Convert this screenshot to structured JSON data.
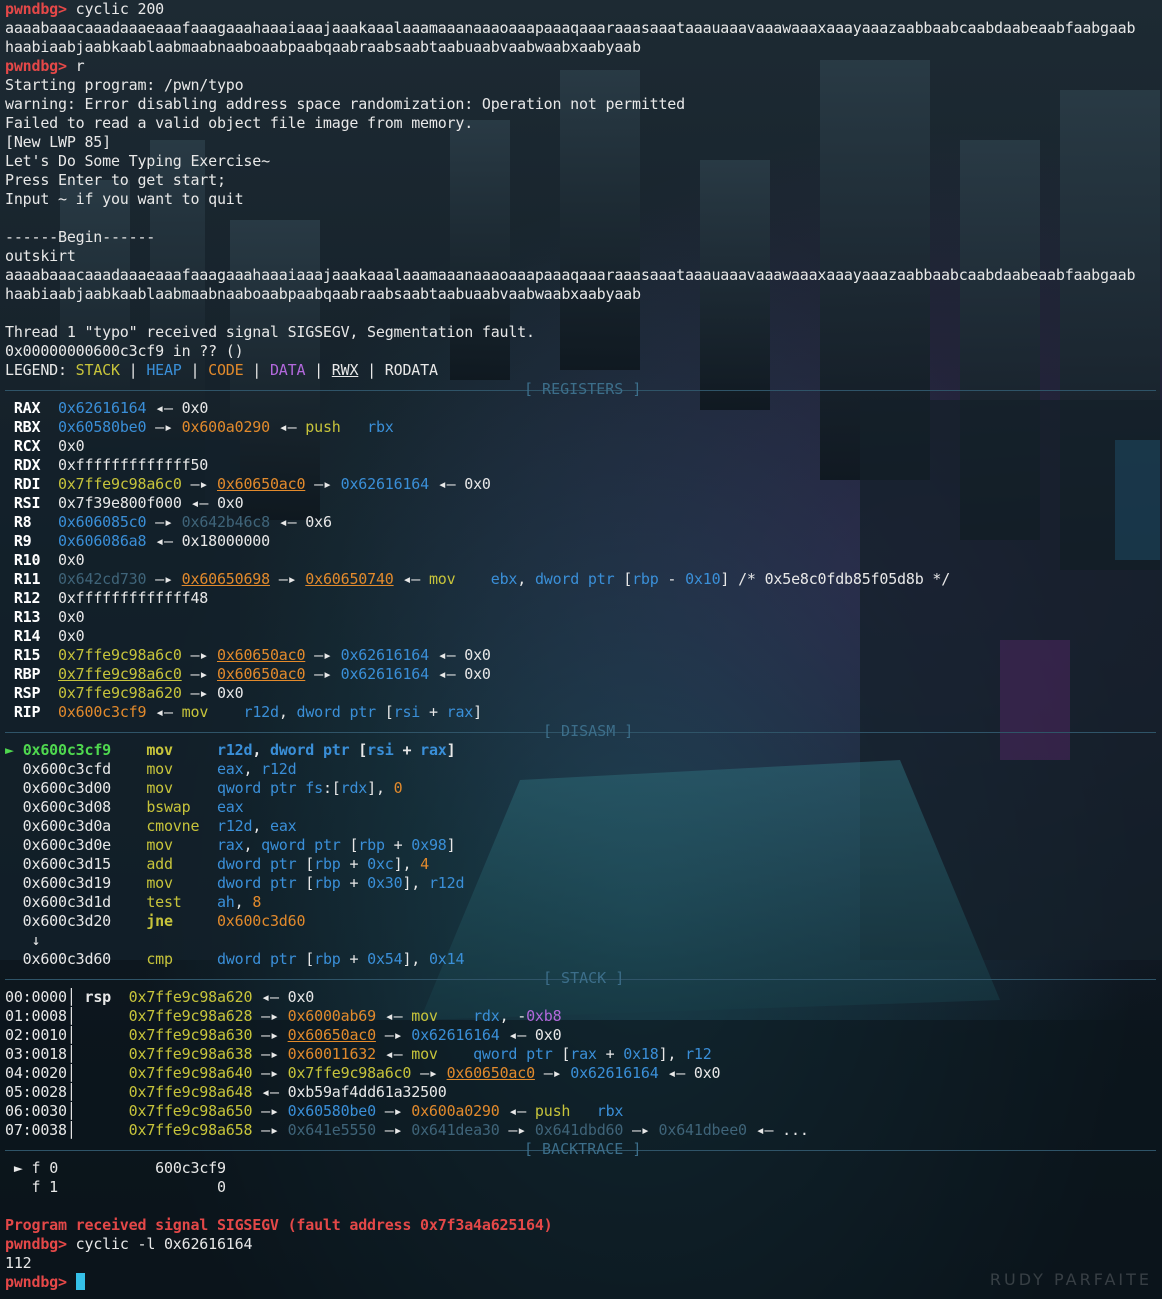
{
  "prompt": "pwndbg>",
  "commands": {
    "cyclic": "cyclic 200",
    "run": "r",
    "lookup": "cyclic -l 0x62616164"
  },
  "cyclic_output": [
    "aaaabaaacaaadaaaeaaafaaagaaahaaaiaaajaaakaaalaaamaaanaaaoaaapaaaqaaaraaasaaataaauaaavaaawaaaxaaayaaazaabbaabcaabdaabeaabfaabgaab",
    "haabiaabjaabkaablaabmaabnaaboaabpaabqaabraabsaabtaabuaabvaabwaabxaabyaab"
  ],
  "program_output": [
    "Starting program: /pwn/typo",
    "warning: Error disabling address space randomization: Operation not permitted",
    "Failed to read a valid object file image from memory.",
    "[New LWP 85]",
    "Let's Do Some Typing Exercise~",
    "Press Enter to get start;",
    "Input ~ if you want to quit",
    "",
    "------Begin------",
    "outskirt",
    "aaaabaaacaaadaaaeaaafaaagaaahaaaiaaajaaakaaalaaamaaanaaaoaaapaaaqaaaraaasaaataaauaaavaaawaaaxaaayaaazaabbaabcaabdaabeaabfaabgaab",
    "haabiaabjaabkaablaabmaabnaaboaabpaabqaabraabsaabtaabuaabvaabwaabxaabyaab",
    "",
    "Thread 1 \"typo\" received signal SIGSEGV, Segmentation fault.",
    "0x00000000600c3cf9 in ?? ()"
  ],
  "legend": {
    "label": "LEGEND: ",
    "stack": "STACK",
    "heap": "HEAP",
    "code": "CODE",
    "data": "DATA",
    "rwx": "RWX",
    "rodata": "RODATA",
    "sep": " | "
  },
  "section_titles": {
    "registers": "[ REGISTERS ]",
    "disasm": "[ DISASM ]",
    "stack": "[ STACK ]",
    "backtrace": "[ BACKTRACE ]"
  },
  "registers": [
    {
      "name": "RAX",
      "value": "0x62616164",
      "rest": " ◂— 0x0"
    },
    {
      "name": "RBX",
      "value": "0x60580be0",
      "rest": " —▸ 0x600a0290 ◂— push   rbx"
    },
    {
      "name": "RCX",
      "value": "0x0",
      "rest": ""
    },
    {
      "name": "RDX",
      "value": "0xfffffffffffff50",
      "rest": ""
    },
    {
      "name": "RDI",
      "value": "0x7ffe9c98a6c0",
      "rest": " —▸ 0x60650ac0 —▸ 0x62616164 ◂— 0x0"
    },
    {
      "name": "RSI",
      "value": "0x7f39e800f000",
      "rest": " ◂— 0x0"
    },
    {
      "name": "R8",
      "value": "0x606085c0",
      "rest": " —▸ 0x642b46c8 ◂— 0x6"
    },
    {
      "name": "R9",
      "value": "0x606086a8",
      "rest": " ◂— 0x18000000"
    },
    {
      "name": "R10",
      "value": "0x0",
      "rest": ""
    },
    {
      "name": "R11",
      "value": "0x642cd730",
      "rest": " —▸ 0x60650698 —▸ 0x60650740 ◂— mov    ebx, dword ptr [rbp - 0x10] /* 0x5e8c0fdb85f05d8b */"
    },
    {
      "name": "R12",
      "value": "0xfffffffffffff48",
      "rest": ""
    },
    {
      "name": "R13",
      "value": "0x0",
      "rest": ""
    },
    {
      "name": "R14",
      "value": "0x0",
      "rest": ""
    },
    {
      "name": "R15",
      "value": "0x7ffe9c98a6c0",
      "rest": " —▸ 0x60650ac0 —▸ 0x62616164 ◂— 0x0"
    },
    {
      "name": "RBP",
      "value": "0x7ffe9c98a6c0",
      "rest": " —▸ 0x60650ac0 —▸ 0x62616164 ◂— 0x0"
    },
    {
      "name": "RSP",
      "value": "0x7ffe9c98a620",
      "rest": " —▸ 0x0"
    },
    {
      "name": "RIP",
      "value": "0x600c3cf9",
      "rest": " ◂— mov    r12d, dword ptr [rsi + rax]"
    }
  ],
  "disasm": [
    {
      "marker": "►",
      "addr": "0x600c3cf9",
      "mnem": "mov",
      "ops": "r12d, dword ptr [rsi + rax]"
    },
    {
      "marker": "",
      "addr": "0x600c3cfd",
      "mnem": "mov",
      "ops": "eax, r12d"
    },
    {
      "marker": "",
      "addr": "0x600c3d00",
      "mnem": "mov",
      "ops": "qword ptr fs:[rdx], 0"
    },
    {
      "marker": "",
      "addr": "0x600c3d08",
      "mnem": "bswap",
      "ops": "eax"
    },
    {
      "marker": "",
      "addr": "0x600c3d0a",
      "mnem": "cmovne",
      "ops": "r12d, eax"
    },
    {
      "marker": "",
      "addr": "0x600c3d0e",
      "mnem": "mov",
      "ops": "rax, qword ptr [rbp + 0x98]"
    },
    {
      "marker": "",
      "addr": "0x600c3d15",
      "mnem": "add",
      "ops": "dword ptr [rbp + 0xc], 4"
    },
    {
      "marker": "",
      "addr": "0x600c3d19",
      "mnem": "mov",
      "ops": "dword ptr [rbp + 0x30], r12d"
    },
    {
      "marker": "",
      "addr": "0x600c3d1d",
      "mnem": "test",
      "ops": "ah, 8"
    },
    {
      "marker": "",
      "addr": "0x600c3d20",
      "mnem": "jne",
      "ops": "0x600c3d60"
    },
    {
      "marker": "↓",
      "addr": "",
      "mnem": "",
      "ops": ""
    },
    {
      "marker": "",
      "addr": "0x600c3d60",
      "mnem": "cmp",
      "ops": "dword ptr [rbp + 0x54], 0x14"
    }
  ],
  "stack": [
    {
      "off": "00:0000",
      "reg": "rsp",
      "addr": "0x7ffe9c98a620",
      "rest": " ◂— 0x0"
    },
    {
      "off": "01:0008",
      "reg": "",
      "addr": "0x7ffe9c98a628",
      "rest": " —▸ 0x6000ab69 ◂— mov    rdx, -0xb8"
    },
    {
      "off": "02:0010",
      "reg": "",
      "addr": "0x7ffe9c98a630",
      "rest": " —▸ 0x60650ac0 —▸ 0x62616164 ◂— 0x0"
    },
    {
      "off": "03:0018",
      "reg": "",
      "addr": "0x7ffe9c98a638",
      "rest": " —▸ 0x60011632 ◂— mov    qword ptr [rax + 0x18], r12"
    },
    {
      "off": "04:0020",
      "reg": "",
      "addr": "0x7ffe9c98a640",
      "rest": " —▸ 0x7ffe9c98a6c0 —▸ 0x60650ac0 —▸ 0x62616164 ◂— 0x0"
    },
    {
      "off": "05:0028",
      "reg": "",
      "addr": "0x7ffe9c98a648",
      "rest": " ◂— 0xb59af4dd61a32500"
    },
    {
      "off": "06:0030",
      "reg": "",
      "addr": "0x7ffe9c98a650",
      "rest": " —▸ 0x60580be0 —▸ 0x600a0290 ◂— push   rbx"
    },
    {
      "off": "07:0038",
      "reg": "",
      "addr": "0x7ffe9c98a658",
      "rest": " —▸ 0x641e5550 —▸ 0x641dea30 —▸ 0x641dbd60 —▸ 0x641dbee0 ◂— ..."
    }
  ],
  "backtrace": [
    {
      "marker": "►",
      "frame": "f 0",
      "addr": "600c3cf9"
    },
    {
      "marker": "",
      "frame": "f 1",
      "addr": "0"
    }
  ],
  "fault_message": "Program received signal SIGSEGV (fault address 0x7f3a4a625164)",
  "lookup_result": "112",
  "watermark": "RUDY PARFAITE",
  "colors": {
    "prompt": "#e44848",
    "stack": "#c7c43b",
    "heap": "#3a8fd8",
    "code": "#e28a2c",
    "data": "#b268dc",
    "cursor": "#35c0e8"
  }
}
